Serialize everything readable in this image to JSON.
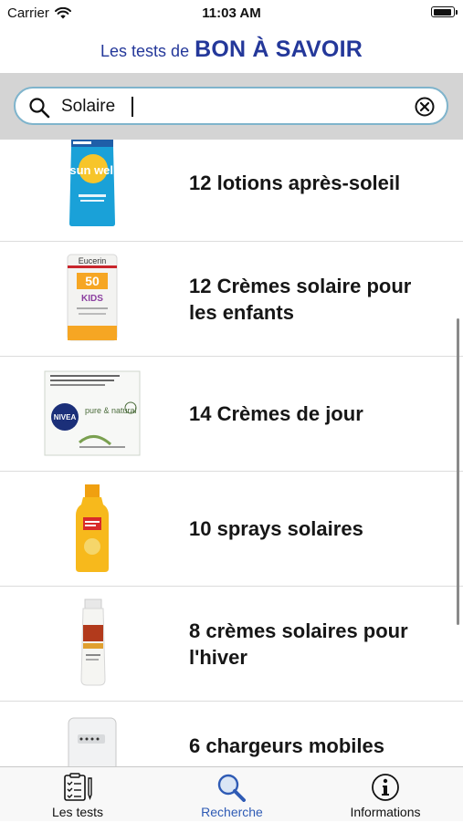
{
  "status_bar": {
    "carrier": "Carrier",
    "time": "11:03 AM"
  },
  "header": {
    "prefix": "Les tests de",
    "brand": "BON À SAVOIR"
  },
  "search": {
    "value": "Solaire"
  },
  "results": [
    {
      "label_lines": [
        "12 lotions après-soleil"
      ],
      "image": "after-sun-lotion-product"
    },
    {
      "label_lines": [
        "12 Crèmes solaire pour",
        "les enfants"
      ],
      "image": "kids-sunscreen-product"
    },
    {
      "label_lines": [
        "14 Crèmes de jour"
      ],
      "image": "day-cream-product"
    },
    {
      "label_lines": [
        "10 sprays solaires"
      ],
      "image": "sun-spray-product"
    },
    {
      "label_lines": [
        "8 crèmes solaires pour",
        "l'hiver"
      ],
      "image": "winter-sunscreen-product"
    },
    {
      "label_lines": [
        "6 chargeurs mobiles"
      ],
      "image": "mobile-charger-product"
    }
  ],
  "product_text": {
    "after_sun": "sun well",
    "kids_brand": "Eucerin",
    "kids_spf": "50",
    "kids_tag": "KIDS",
    "day_cream_brand": "NIVEA",
    "day_cream_line": "pure & natural"
  },
  "tabs": [
    {
      "label": "Les tests",
      "icon": "clipboard-checklist-icon",
      "active": false
    },
    {
      "label": "Recherche",
      "icon": "search-icon",
      "active": true
    },
    {
      "label": "Informations",
      "icon": "info-icon",
      "active": false
    }
  ],
  "colors": {
    "brand": "#24389a",
    "active_tab": "#2f5bb5",
    "search_border": "#7fb4cc"
  }
}
